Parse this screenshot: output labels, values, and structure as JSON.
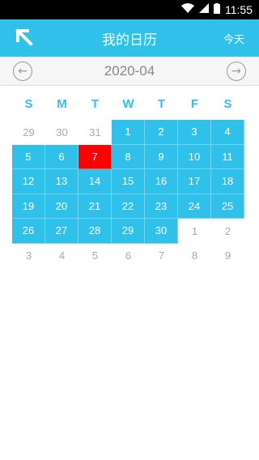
{
  "status": {
    "time": "11:55"
  },
  "header": {
    "title": "我的日历",
    "today_label": "今天"
  },
  "month": {
    "label": "2020-04"
  },
  "weekdays": [
    "S",
    "M",
    "T",
    "W",
    "T",
    "F",
    "S"
  ],
  "days": [
    {
      "d": "29",
      "cur": false
    },
    {
      "d": "30",
      "cur": false
    },
    {
      "d": "31",
      "cur": false
    },
    {
      "d": "1",
      "cur": true
    },
    {
      "d": "2",
      "cur": true
    },
    {
      "d": "3",
      "cur": true
    },
    {
      "d": "4",
      "cur": true
    },
    {
      "d": "5",
      "cur": true
    },
    {
      "d": "6",
      "cur": true
    },
    {
      "d": "7",
      "cur": true,
      "today": true
    },
    {
      "d": "8",
      "cur": true
    },
    {
      "d": "9",
      "cur": true
    },
    {
      "d": "10",
      "cur": true
    },
    {
      "d": "11",
      "cur": true
    },
    {
      "d": "12",
      "cur": true
    },
    {
      "d": "13",
      "cur": true
    },
    {
      "d": "14",
      "cur": true
    },
    {
      "d": "15",
      "cur": true
    },
    {
      "d": "16",
      "cur": true
    },
    {
      "d": "17",
      "cur": true
    },
    {
      "d": "18",
      "cur": true
    },
    {
      "d": "19",
      "cur": true
    },
    {
      "d": "20",
      "cur": true
    },
    {
      "d": "21",
      "cur": true
    },
    {
      "d": "22",
      "cur": true
    },
    {
      "d": "23",
      "cur": true
    },
    {
      "d": "24",
      "cur": true
    },
    {
      "d": "25",
      "cur": true
    },
    {
      "d": "26",
      "cur": true
    },
    {
      "d": "27",
      "cur": true
    },
    {
      "d": "28",
      "cur": true
    },
    {
      "d": "29",
      "cur": true
    },
    {
      "d": "30",
      "cur": true
    },
    {
      "d": "1",
      "cur": false
    },
    {
      "d": "2",
      "cur": false
    },
    {
      "d": "3",
      "cur": false
    },
    {
      "d": "4",
      "cur": false
    },
    {
      "d": "5",
      "cur": false
    },
    {
      "d": "6",
      "cur": false
    },
    {
      "d": "7",
      "cur": false
    },
    {
      "d": "8",
      "cur": false
    },
    {
      "d": "9",
      "cur": false
    }
  ],
  "colors": {
    "accent": "#2fc1ea",
    "today": "#ff0000"
  }
}
